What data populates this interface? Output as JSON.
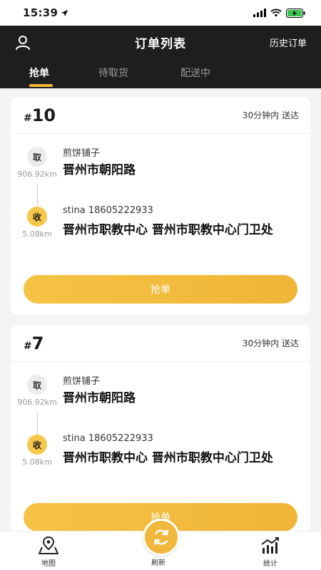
{
  "status_bar": {
    "time": "15:39"
  },
  "header": {
    "title": "订单列表",
    "history_label": "历史订单",
    "tabs": [
      "抢单",
      "待取货",
      "配送中"
    ],
    "active_tab": 0
  },
  "orders": [
    {
      "hash": "#",
      "number": "10",
      "delivery_time": "30分钟内 送达",
      "pickup_badge": "取",
      "pickup_distance": "906.92km",
      "pickup_name": "煎饼铺子",
      "pickup_address": "晋州市朝阳路",
      "drop_badge": "收",
      "drop_distance": "5.08km",
      "receiver": "stina 18605222933",
      "drop_address": "晋州市职教中心 晋州市职教中心门卫处",
      "button_label": "抢单"
    },
    {
      "hash": "#",
      "number": "7",
      "delivery_time": "30分钟内 送达",
      "pickup_badge": "取",
      "pickup_distance": "906.92km",
      "pickup_name": "煎饼铺子",
      "pickup_address": "晋州市朝阳路",
      "drop_badge": "收",
      "drop_distance": "5.08km",
      "receiver": "stina 18605222933",
      "drop_address": "晋州市职教中心 晋州市职教中心门卫处",
      "button_label": "抢单"
    }
  ],
  "bottom_nav": {
    "map_label": "地图",
    "refresh_label": "刷新",
    "stats_label": "统计"
  },
  "colors": {
    "accent": "#f0b53a",
    "header_bg": "#1e1e1e",
    "badge_pick": "#ececec",
    "badge_drop": "#f5c74b"
  }
}
